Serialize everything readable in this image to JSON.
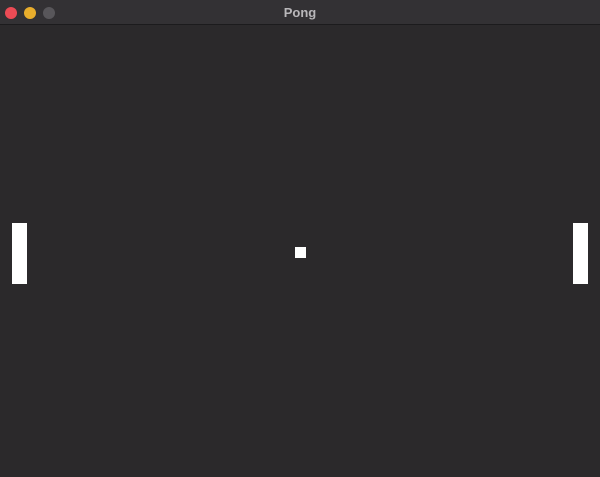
{
  "window": {
    "title": "Pong",
    "buttons": {
      "close_color": "#ec4b55",
      "minimize_color": "#e8ad2c",
      "zoom_color": "#58565a"
    }
  },
  "game": {
    "background_color": "#2b292b",
    "paddle_color": "#ffffff",
    "ball_color": "#ffffff"
  }
}
